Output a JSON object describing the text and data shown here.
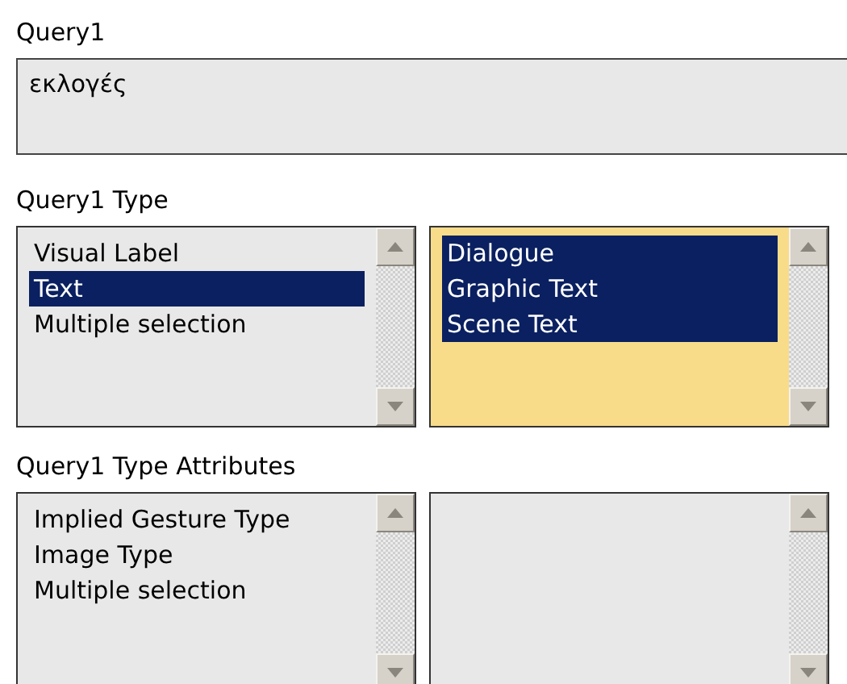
{
  "query": {
    "label": "Query1",
    "value": "εκλογές"
  },
  "type_section": {
    "label": "Query1 Type",
    "lists": [
      {
        "focused": false,
        "items": [
          {
            "label": "Visual Label",
            "selected": false
          },
          {
            "label": "Text",
            "selected": true
          },
          {
            "label": "Multiple selection",
            "selected": false
          }
        ]
      },
      {
        "focused": true,
        "items": [
          {
            "label": "Dialogue",
            "selected": true
          },
          {
            "label": "Graphic Text",
            "selected": true
          },
          {
            "label": "Scene Text",
            "selected": true
          }
        ]
      }
    ]
  },
  "attributes_section": {
    "label": "Query1 Type Attributes",
    "lists": [
      {
        "focused": false,
        "items": [
          {
            "label": "Implied Gesture Type",
            "selected": false
          },
          {
            "label": "Image Type",
            "selected": false
          },
          {
            "label": "Multiple selection",
            "selected": false
          }
        ]
      },
      {
        "focused": false
      }
    ]
  }
}
